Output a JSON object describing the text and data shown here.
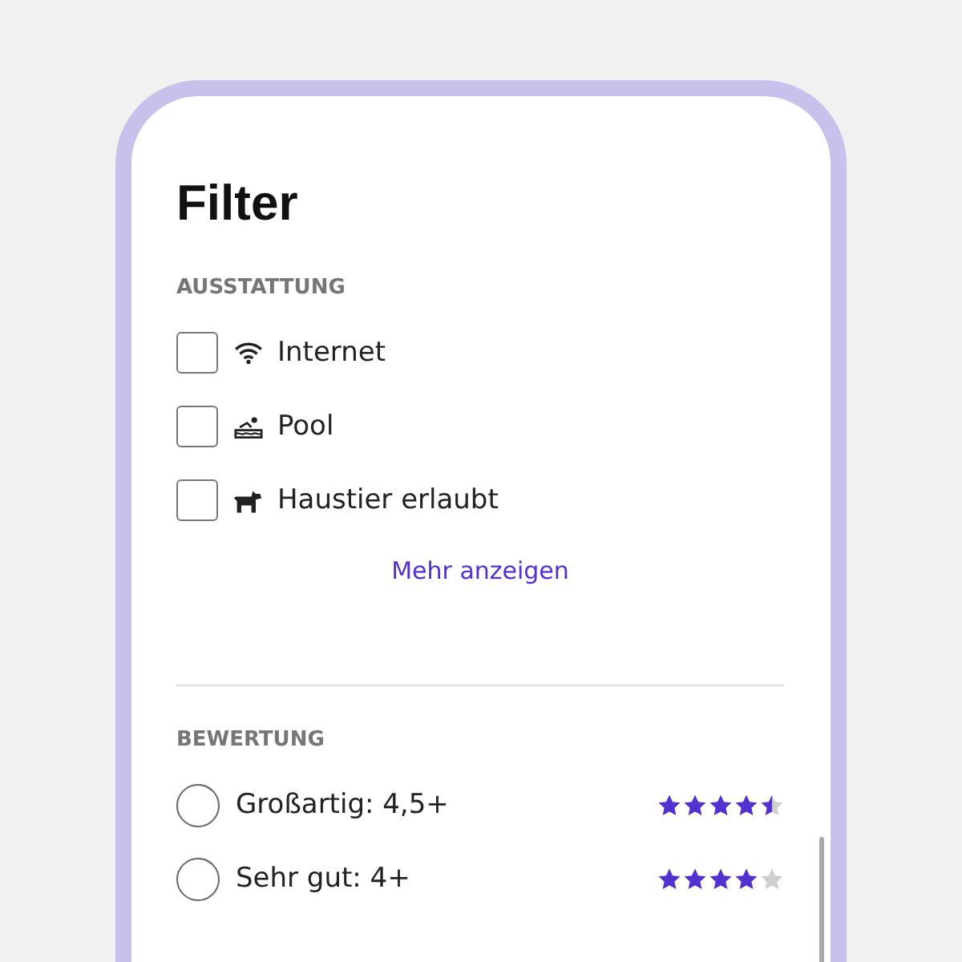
{
  "title": "Filter",
  "amenities": {
    "heading": "AUSSTATTUNG",
    "items": [
      {
        "kind": "wifi",
        "label": "Internet",
        "checked": false
      },
      {
        "kind": "pool",
        "label": "Pool",
        "checked": false
      },
      {
        "kind": "pet",
        "label": "Haustier erlaubt",
        "checked": false
      }
    ],
    "more_link": "Mehr anzeigen"
  },
  "rating": {
    "heading": "BEWERTUNG",
    "options": [
      {
        "label": "Großartig: 4,5+",
        "selected": false,
        "stars": 4.5
      },
      {
        "label": "Sehr gut: 4+",
        "selected": false,
        "stars": 4
      }
    ]
  }
}
